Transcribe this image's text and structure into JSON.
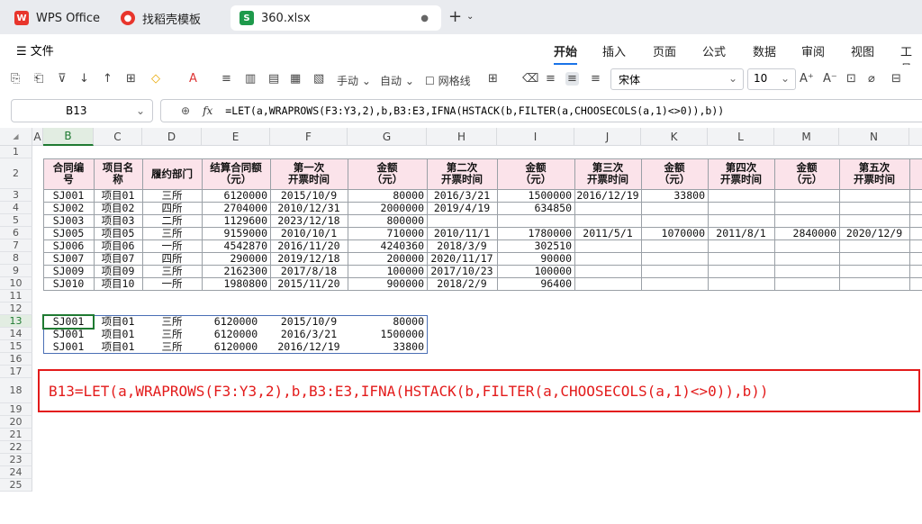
{
  "tabs": [
    {
      "label": "WPS Office",
      "icon": "wps-logo-icon"
    },
    {
      "label": "找稻壳模板",
      "icon": "docer-icon"
    },
    {
      "label": "360.xlsx",
      "icon": "sheet-icon",
      "active": true
    }
  ],
  "menu": {
    "file": "文件",
    "items": [
      "开始",
      "插入",
      "页面",
      "公式",
      "数据",
      "审阅",
      "视图",
      "工具"
    ]
  },
  "toolbar": {
    "handmove": "手动",
    "auto": "自动",
    "gridlines": "网格线",
    "font": "宋体",
    "size": "10"
  },
  "formula_bar": {
    "cell_ref": "B13",
    "fx": "fx",
    "formula": "=LET(a,WRAPROWS(F3:Y3,2),b,B3:E3,IFNA(HSTACK(b,FILTER(a,CHOOSECOLS(a,1)<>0)),b))"
  },
  "columns": [
    "A",
    "B",
    "C",
    "D",
    "E",
    "F",
    "G",
    "H",
    "I",
    "J",
    "K",
    "L",
    "M",
    "N"
  ],
  "rows": [
    "1",
    "2",
    "3",
    "4",
    "5",
    "6",
    "7",
    "8",
    "9",
    "10",
    "11",
    "12",
    "13",
    "14",
    "15",
    "16",
    "17",
    "18",
    "19",
    "20",
    "21",
    "22",
    "23",
    "24",
    "25"
  ],
  "table_headers": [
    "合同编\n号",
    "项目名\n称",
    "履约部门",
    "结算合同额\n（元）",
    "第一次\n开票时间",
    "金额\n（元）",
    "第二次\n开票时间",
    "金额\n（元）",
    "第三次\n开票时间",
    "金额\n（元）",
    "第四次\n开票时间",
    "金额\n（元）",
    "第五次\n开票时间"
  ],
  "table_rows": [
    [
      "SJ001",
      "项目01",
      "三所",
      "6120000",
      "2015/10/9",
      "80000",
      "2016/3/21",
      "1500000",
      "2016/12/19",
      "33800",
      "",
      "",
      ""
    ],
    [
      "SJ002",
      "项目02",
      "四所",
      "2704000",
      "2010/12/31",
      "2000000",
      "2019/4/19",
      "634850",
      "",
      "",
      "",
      "",
      ""
    ],
    [
      "SJ003",
      "项目03",
      "二所",
      "1129600",
      "2023/12/18",
      "800000",
      "",
      "",
      "",
      "",
      "",
      "",
      ""
    ],
    [
      "SJ005",
      "项目05",
      "三所",
      "9159000",
      "2010/10/1",
      "710000",
      "2010/11/1",
      "1780000",
      "2011/5/1",
      "1070000",
      "2011/8/1",
      "2840000",
      "2020/12/9"
    ],
    [
      "SJ006",
      "项目06",
      "一所",
      "4542870",
      "2016/11/20",
      "4240360",
      "2018/3/9",
      "302510",
      "",
      "",
      "",
      "",
      ""
    ],
    [
      "SJ007",
      "项目07",
      "四所",
      "290000",
      "2019/12/18",
      "200000",
      "2020/11/17",
      "90000",
      "",
      "",
      "",
      "",
      ""
    ],
    [
      "SJ009",
      "项目09",
      "三所",
      "2162300",
      "2017/8/18",
      "100000",
      "2017/10/23",
      "100000",
      "",
      "",
      "",
      "",
      ""
    ],
    [
      "SJ010",
      "项目10",
      "一所",
      "1980800",
      "2015/11/20",
      "900000",
      "2018/2/9",
      "96400",
      "",
      "",
      "",
      "",
      ""
    ]
  ],
  "result_rows": [
    [
      "SJ001",
      "项目01",
      "三所",
      "6120000",
      "2015/10/9",
      "80000"
    ],
    [
      "SJ001",
      "项目01",
      "三所",
      "6120000",
      "2016/3/21",
      "1500000"
    ],
    [
      "SJ001",
      "项目01",
      "三所",
      "6120000",
      "2016/12/19",
      "33800"
    ]
  ],
  "note": "B13=LET(a,WRAPROWS(F3:Y3,2),b,B3:E3,IFNA(HSTACK(b,FILTER(a,CHOOSECOLS(a,1)<>0)),b))"
}
